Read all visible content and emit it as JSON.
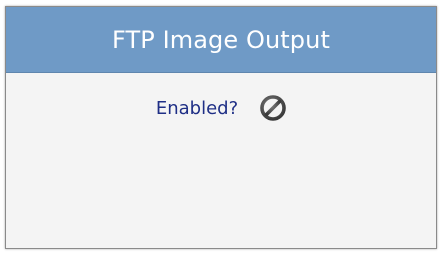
{
  "panel": {
    "title": "FTP Image Output",
    "enabled_label": "Enabled?",
    "enabled_state": "disabled",
    "toggle_icon": "disabled-icon"
  }
}
